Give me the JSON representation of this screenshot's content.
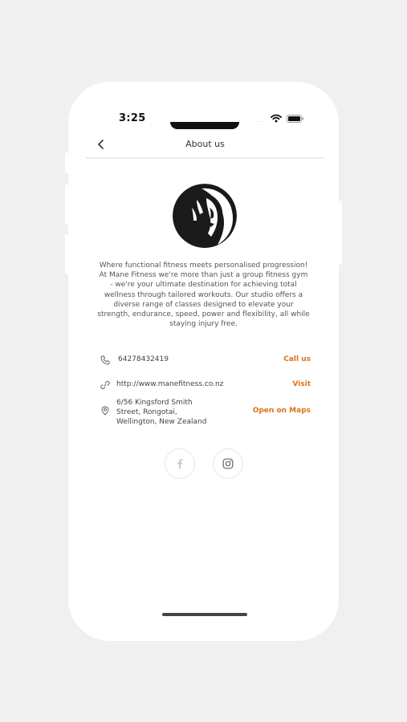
{
  "status_bar": {
    "time": "3:25",
    "signal": "....",
    "icons": [
      "wifi-icon",
      "battery-icon"
    ]
  },
  "header": {
    "title": "About us",
    "back_icon": "chevron-left-icon"
  },
  "logo": {
    "icon": "lion-logo",
    "colors": {
      "background": "#1a1a1a",
      "figure": "#ffffff"
    }
  },
  "about": {
    "description": "Where functional fitness meets personalised progression! At Mane Fitness we're more than just a group fitness gym - we're your ultimate destination for achieving total wellness through tailored workouts. Our studio offers a diverse range of classes designed to elevate your strength, endurance, speed, power and flexibility, all while staying injury free."
  },
  "contact": {
    "phone": {
      "value": "64278432419",
      "action": "Call us",
      "icon": "phone-icon"
    },
    "website": {
      "value": "http://www.manefitness.co.nz",
      "action": "Visit",
      "icon": "link-icon"
    },
    "address": {
      "lines": [
        "6/56 Kingsford Smith",
        "Street, Rongotai,",
        "Wellington, New Zealand"
      ],
      "action": "Open on Maps",
      "icon": "map-pin-icon"
    }
  },
  "social": [
    {
      "name": "facebook",
      "icon": "facebook-icon"
    },
    {
      "name": "instagram",
      "icon": "instagram-icon"
    }
  ],
  "theme": {
    "accent": "#d9731a",
    "background": "#f0f0f0",
    "phone_background": "#ffffff"
  }
}
